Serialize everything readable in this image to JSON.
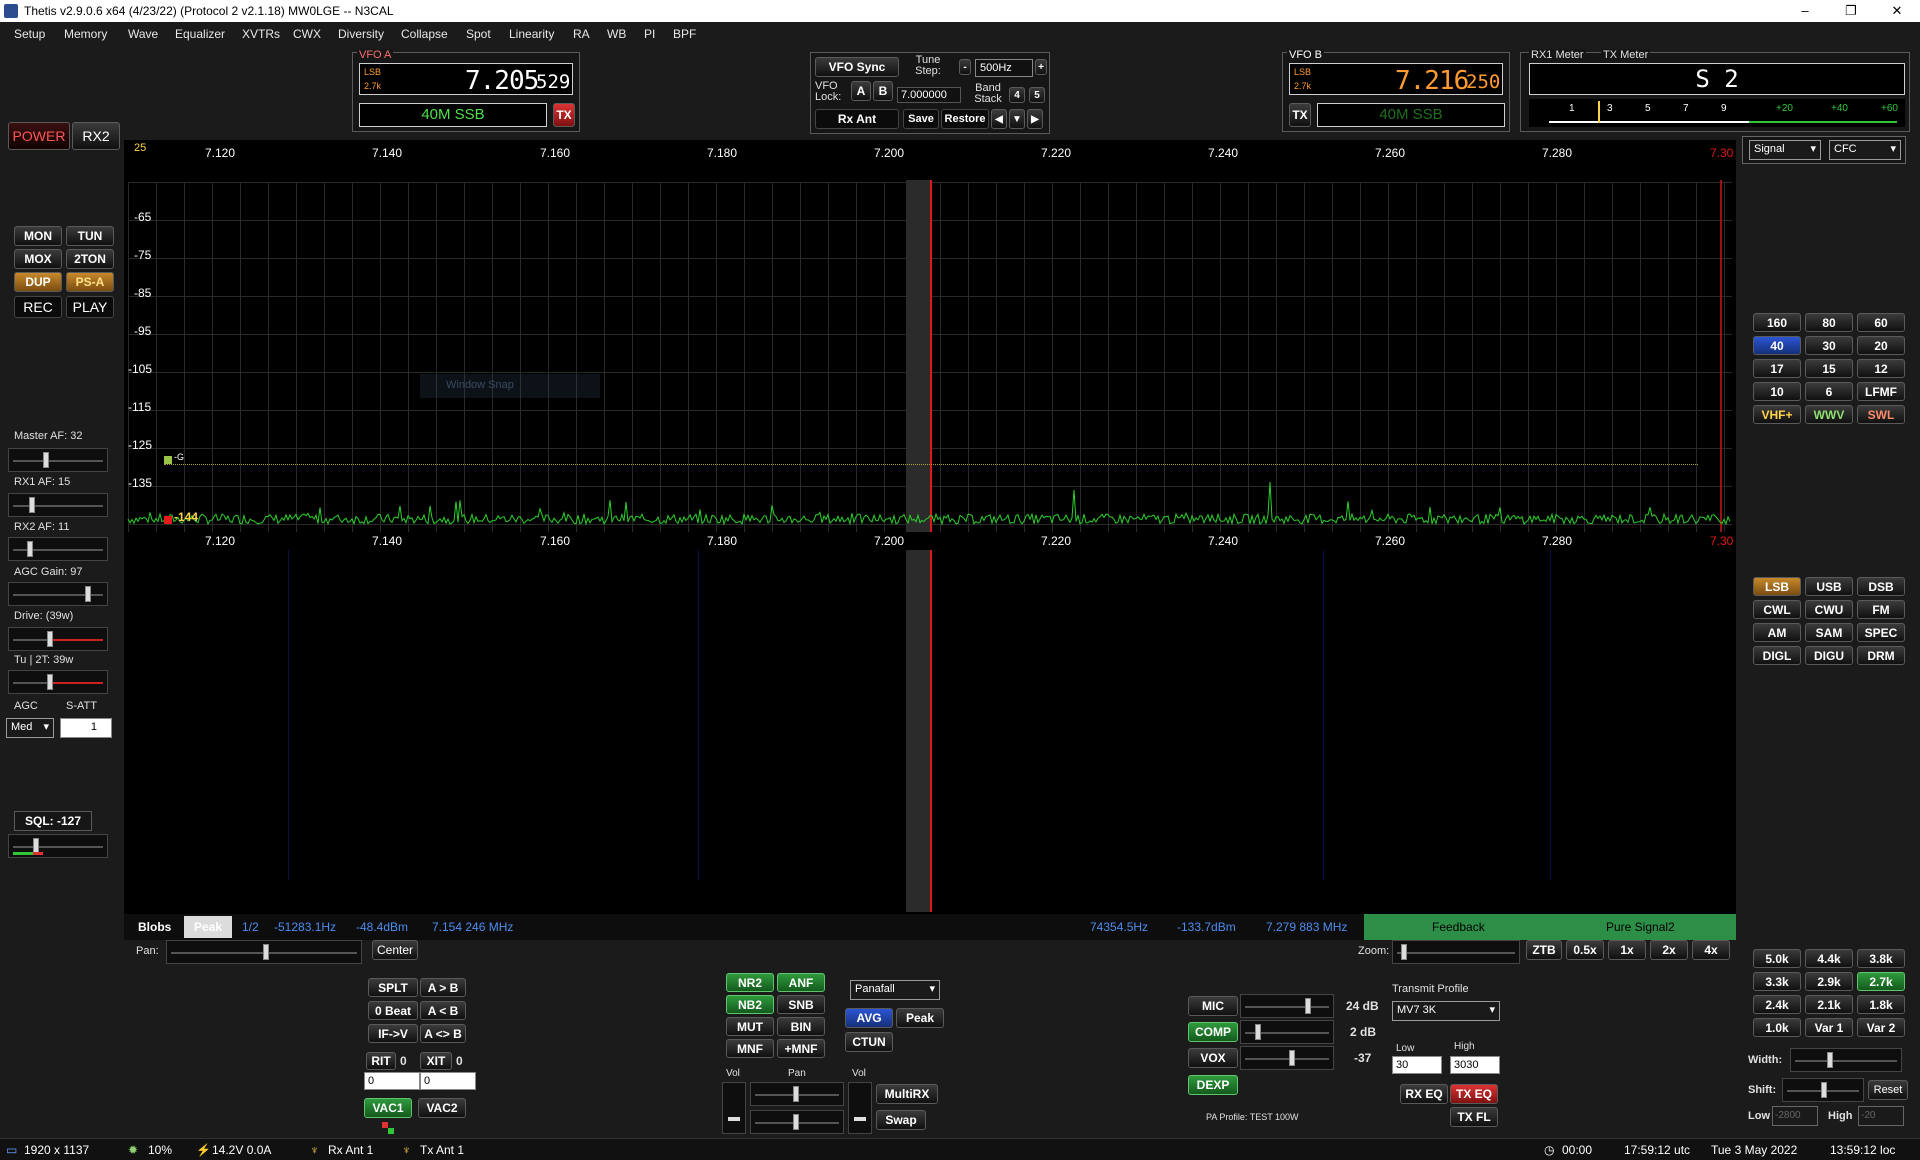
{
  "titlebar": {
    "title": "Thetis v2.9.0.6 x64 (4/23/22) (Protocol 2 v2.1.18) MW0LGE  --  N3CAL",
    "minimize": "–",
    "restore": "❐",
    "close": "✕"
  },
  "menu": [
    "Setup",
    "Memory",
    "Wave",
    "Equalizer",
    "XVTRs",
    "CWX",
    "Diversity",
    "Collapse",
    "Spot",
    "Linearity",
    "RA",
    "WB",
    "PI",
    "BPF"
  ],
  "vfoa": {
    "label": "VFO A",
    "mode": "LSB",
    "bw": "2.7k",
    "freq_main": "7.205",
    "freq_sub": "529",
    "band": "40M SSB",
    "tx": "TX"
  },
  "vfob": {
    "label": "VFO B",
    "mode": "LSB",
    "bw": "2.7k",
    "freq_main": "7.216",
    "freq_sub": "250",
    "band": "40M SSB",
    "tx": "TX"
  },
  "vfosync": {
    "sync": "VFO Sync",
    "tune_step_label": "Tune Step:",
    "tune_step": "500Hz",
    "minus": "-",
    "plus": "+",
    "lock_label": "VFO Lock:",
    "a": "A",
    "b": "B",
    "lock_value": "7.000000",
    "band_stack_label": "Band Stack",
    "bs_num": "4",
    "bs_5": "5",
    "rx_ant": "Rx Ant",
    "save": "Save",
    "restore": "Restore",
    "prev": "◀",
    "down": "▼",
    "next": "▶"
  },
  "meter": {
    "rx_label": "RX1 Meter",
    "tx_label": "TX Meter",
    "reading": "S 2",
    "scale": [
      "1",
      "3",
      "5",
      "7",
      "9",
      "+20",
      "+40",
      "+60"
    ],
    "signal": "Signal",
    "cfc": "CFC"
  },
  "left": {
    "power": "POWER",
    "rx2": "RX2",
    "mon": "MON",
    "tun": "TUN",
    "mox": "MOX",
    "ton2": "2TON",
    "dup": "DUP",
    "psa": "PS-A",
    "rec": "REC",
    "play": "PLAY",
    "master_af": "Master AF:  32",
    "rx1_af": "RX1 AF:  15",
    "rx2_af": "RX2 AF:  11",
    "agc_gain": "AGC Gain:  97",
    "drive": "Drive:  (39w)",
    "tu2t": "Tu | 2T:  39w",
    "agc": "AGC",
    "satt": "S-ATT",
    "agc_mode": "Med",
    "satt_val": "1",
    "sql": "SQL:  -127"
  },
  "spectrum": {
    "top_num": "25",
    "freqs": [
      "7.120",
      "7.140",
      "7.160",
      "7.180",
      "7.200",
      "7.220",
      "7.240",
      "7.260",
      "7.280",
      "7.30"
    ],
    "db": [
      "-65",
      "-75",
      "-85",
      "-95",
      "-105",
      "-115",
      "-125",
      "-135",
      "-144"
    ],
    "marker_g": "-G",
    "window_snap": "Window Snap"
  },
  "infobar": {
    "blobs": "Blobs",
    "peak": "Peak",
    "ratio": "1/2",
    "off1": "-51283.1Hz",
    "dbm1": "-48.4dBm",
    "f1": "7.154 246 MHz",
    "off2": "74354.5Hz",
    "dbm2": "-133.7dBm",
    "f2": "7.279 883 MHz",
    "feedback": "Feedback",
    "puresignal": "Pure Signal2"
  },
  "panzoom": {
    "pan": "Pan:",
    "center": "Center",
    "zoom": "Zoom:",
    "ztb": "ZTB",
    "z05": "0.5x",
    "z1": "1x",
    "z2": "2x",
    "z4": "4x"
  },
  "bands": [
    "160",
    "80",
    "60",
    "40",
    "30",
    "20",
    "17",
    "15",
    "12",
    "10",
    "6",
    "LFMF",
    "VHF+",
    "WWV",
    "SWL"
  ],
  "modes": [
    "LSB",
    "USB",
    "DSB",
    "CWL",
    "CWU",
    "FM",
    "AM",
    "SAM",
    "SPEC",
    "DIGL",
    "DIGU",
    "DRM"
  ],
  "filters": [
    "5.0k",
    "4.4k",
    "3.8k",
    "3.3k",
    "2.9k",
    "2.7k",
    "2.4k",
    "2.1k",
    "1.8k",
    "1.0k",
    "Var 1",
    "Var 2"
  ],
  "filterctl": {
    "width": "Width:",
    "shift": "Shift:",
    "reset": "Reset",
    "low": "Low",
    "low_val": "-2800",
    "high": "High",
    "high_val": "-20"
  },
  "split": {
    "splt": "SPLT",
    "atob": "A > B",
    "zerobeat": "0 Beat",
    "altb": "A < B",
    "ifv": "IF->V",
    "aswapb": "A <> B",
    "rit": "RIT",
    "rit_v": "0",
    "xit": "XIT",
    "xit_v": "0",
    "rit_num": "0",
    "xit_num": "0",
    "vac1": "VAC1",
    "vac2": "VAC2"
  },
  "dsp": {
    "nr2": "NR2",
    "anf": "ANF",
    "nb2": "NB2",
    "snb": "SNB",
    "mut": "MUT",
    "bin": "BIN",
    "mnf": "MNF",
    "pmnf": "+MNF",
    "display_mode": "Panafall",
    "avg": "AVG",
    "peak": "Peak",
    "ctun": "CTUN"
  },
  "audio": {
    "vol": "Vol",
    "pan": "Pan",
    "vol2": "Vol",
    "multirx": "MultiRX",
    "swap": "Swap"
  },
  "tx": {
    "mic": "MIC",
    "mic_db": "24 dB",
    "comp": "COMP",
    "comp_db": "2 dB",
    "vox": "VOX",
    "vox_v": "-37",
    "dexp": "DEXP",
    "profile_label": "Transmit Profile",
    "profile": "MV7 3K",
    "low_label": "Low",
    "high_label": "High",
    "low_val": "30",
    "high_val": "3030",
    "rxeq": "RX EQ",
    "txeq": "TX EQ",
    "txfl": "TX FL",
    "pa_profile": "PA Profile: TEST 100W"
  },
  "status": {
    "res": "1920 x 1137",
    "cpu": "10%",
    "volts": "14.2V  0.0A",
    "rxant": "Rx Ant  1",
    "txant": "Tx Ant  1",
    "timer": "00:00",
    "utc": "17:59:12 utc",
    "date": "Tue 3 May 2022",
    "local": "13:59:12 loc"
  }
}
